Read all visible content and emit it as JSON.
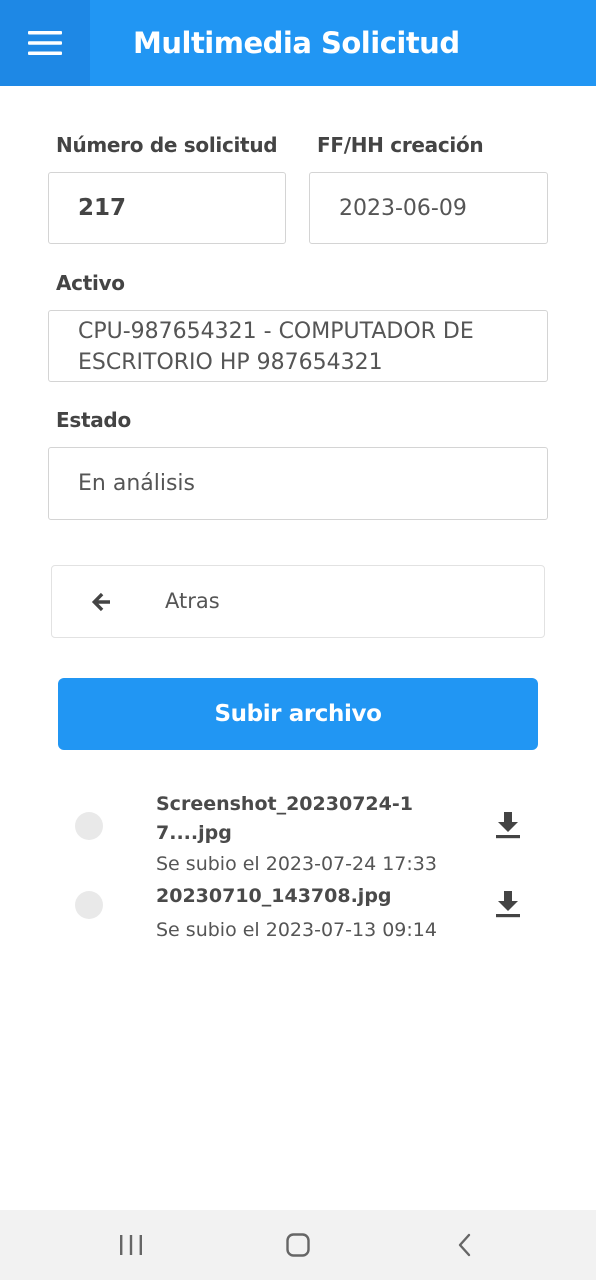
{
  "header": {
    "title": "Multimedia Solicitud",
    "menu_icon": "hamburger-menu-icon"
  },
  "form": {
    "numero_label": "Número de solicitud",
    "numero_value": "217",
    "fecha_label": "FF/HH creación",
    "fecha_value": "2023-06-09",
    "activo_label": "Activo",
    "activo_value": "CPU-987654321 - COMPUTADOR DE ESCRITORIO HP 987654321",
    "estado_label": "Estado",
    "estado_value": "En análisis"
  },
  "actions": {
    "back_label": "Atras",
    "back_icon": "arrow-left-icon",
    "upload_label": "Subir archivo"
  },
  "files": [
    {
      "name": "Screenshot_20230724-17....jpg",
      "date": "Se subio el 2023-07-24 17:33",
      "icon": "download-icon"
    },
    {
      "name": "20230710_143708.jpg",
      "date": "Se subio el 2023-07-13 09:14",
      "icon": "download-icon"
    }
  ],
  "colors": {
    "primary": "#2196f3",
    "primary_dark": "#1e88e5",
    "navbar": "#f2f2f2"
  },
  "navbar": {
    "icons": [
      "recent-apps-icon",
      "home-icon",
      "back-icon"
    ]
  }
}
